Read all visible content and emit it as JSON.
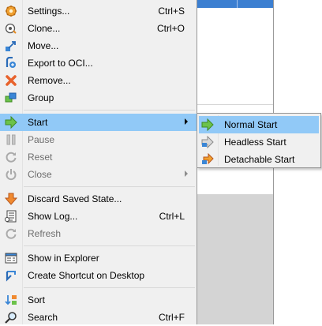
{
  "menu": {
    "items": [
      {
        "label": "Settings...",
        "shortcut": "Ctrl+S",
        "icon": "settings-icon"
      },
      {
        "label": "Clone...",
        "shortcut": "Ctrl+O",
        "icon": "clone-icon"
      },
      {
        "label": "Move...",
        "shortcut": "",
        "icon": "move-icon"
      },
      {
        "label": "Export to OCI...",
        "shortcut": "",
        "icon": "export-oci-icon"
      },
      {
        "label": "Remove...",
        "shortcut": "",
        "icon": "remove-icon"
      },
      {
        "label": "Group",
        "shortcut": "",
        "icon": "group-icon"
      },
      {
        "label": "Start",
        "shortcut": "",
        "icon": "start-arrow-icon"
      },
      {
        "label": "Pause",
        "shortcut": "",
        "icon": "pause-icon"
      },
      {
        "label": "Reset",
        "shortcut": "",
        "icon": "reset-icon"
      },
      {
        "label": "Close",
        "shortcut": "",
        "icon": "power-icon"
      },
      {
        "label": "Discard Saved State...",
        "shortcut": "",
        "icon": "discard-icon"
      },
      {
        "label": "Show Log...",
        "shortcut": "Ctrl+L",
        "icon": "log-icon"
      },
      {
        "label": "Refresh",
        "shortcut": "",
        "icon": "refresh-icon"
      },
      {
        "label": "Show in Explorer",
        "shortcut": "",
        "icon": "explorer-icon"
      },
      {
        "label": "Create Shortcut on Desktop",
        "shortcut": "",
        "icon": "shortcut-icon"
      },
      {
        "label": "Sort",
        "shortcut": "",
        "icon": "sort-icon"
      },
      {
        "label": "Search",
        "shortcut": "Ctrl+F",
        "icon": "search-icon"
      }
    ]
  },
  "submenu": {
    "items": [
      {
        "label": "Normal Start",
        "icon": "normal-start-icon"
      },
      {
        "label": "Headless Start",
        "icon": "headless-start-icon"
      },
      {
        "label": "Detachable Start",
        "icon": "detachable-start-icon"
      }
    ]
  },
  "colors": {
    "highlight": "#91c9f7",
    "menu_bg": "#f0f0f0",
    "disabled_text": "#6d6d6d",
    "start_green": "#6cc24a",
    "remove_orange": "#e8622c",
    "header_blue": "#3c7fd1"
  }
}
